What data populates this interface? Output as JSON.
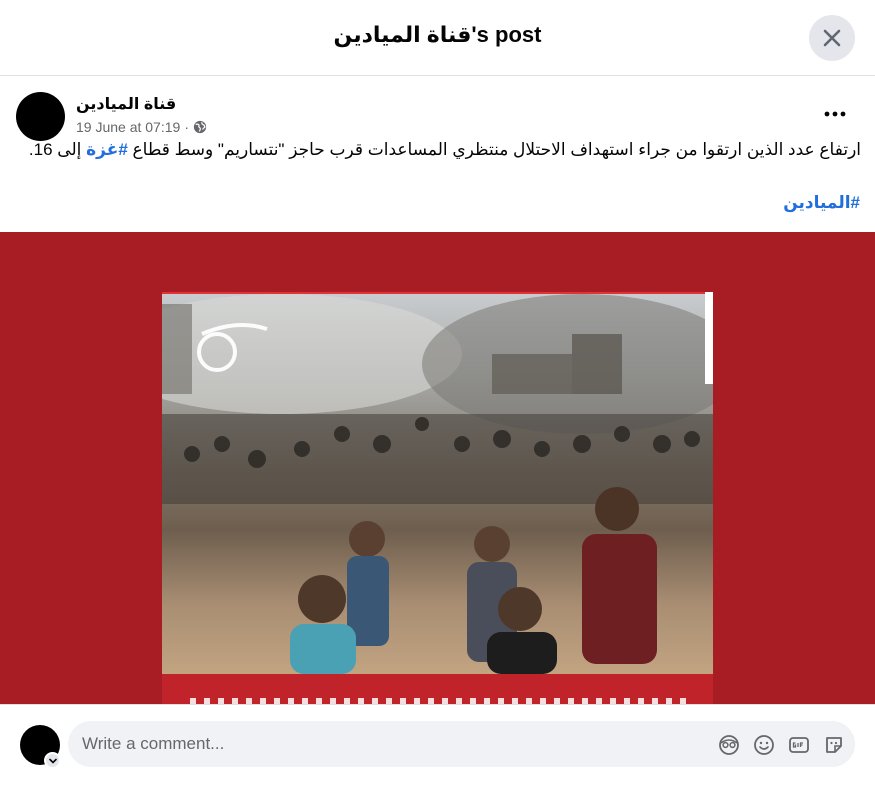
{
  "header": {
    "title": "قناة الميادين's post"
  },
  "post": {
    "author": "قناة الميادين",
    "timestamp": "19 June at 07:19",
    "separator": "·",
    "text_before_hashtag": "ارتفاع عدد الذين ارتقوا من جراء استهداف الاحتلال منتظري المساعدات قرب حاجز \"نتساريم\" وسط قطاع ",
    "hashtag_gaza": "#غزة",
    "text_after_hashtag": " إلى 16.",
    "hashtag_channel": "#الميادين"
  },
  "composer": {
    "placeholder": "Write a comment..."
  },
  "colors": {
    "media_red": "#a81d23",
    "link_blue": "#216fdb",
    "muted": "#65676b"
  },
  "icons": {
    "close": "close-icon",
    "more": "more-horizontal-icon",
    "globe": "globe-icon",
    "avatar_chevron": "chevron-down-icon",
    "avatar_sticker": "avatar-sticker-icon",
    "emoji": "emoji-icon",
    "gif": "gif-icon",
    "sticker": "sticker-icon"
  }
}
